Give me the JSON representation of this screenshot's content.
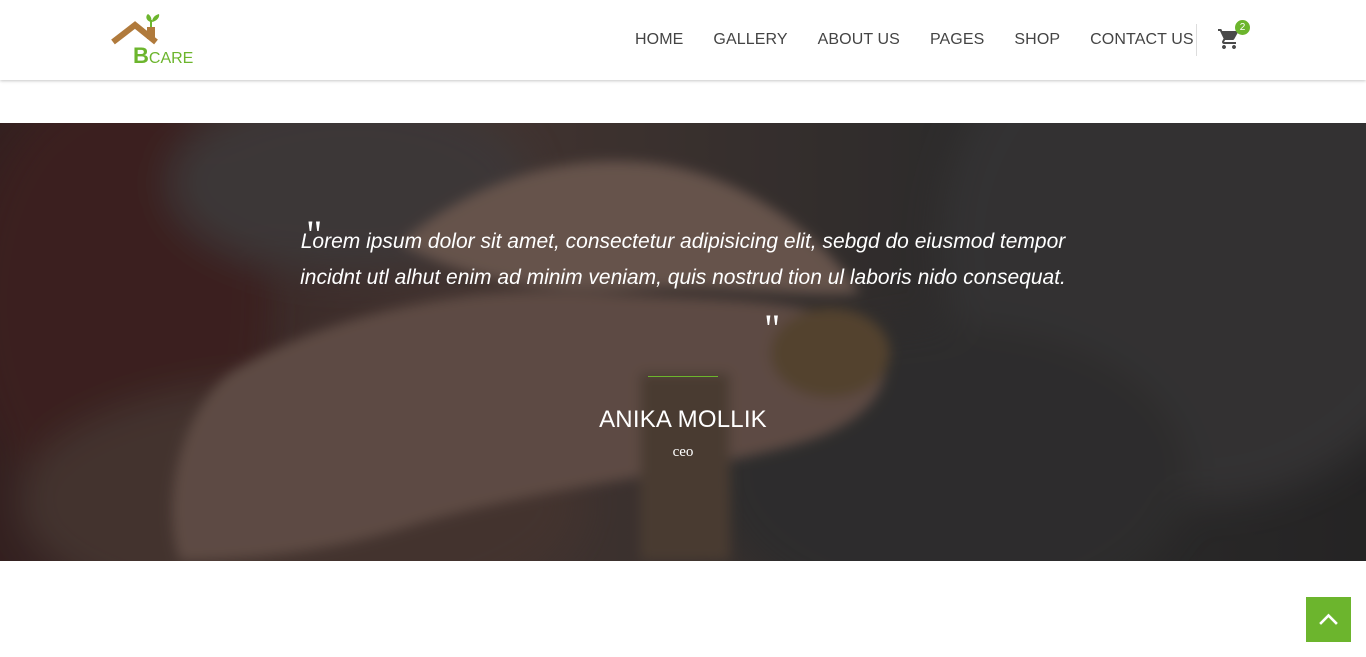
{
  "brand": {
    "logo_big": "B",
    "logo_small": "CARE",
    "accent_color": "#6cb52d",
    "roof_color": "#b07a3c"
  },
  "nav": {
    "items": [
      {
        "label": "HOME"
      },
      {
        "label": "GALLERY"
      },
      {
        "label": "ABOUT US"
      },
      {
        "label": "PAGES"
      },
      {
        "label": "SHOP"
      },
      {
        "label": "CONTACT US"
      }
    ]
  },
  "cart": {
    "icon": "cart-icon",
    "count": "2"
  },
  "testimonial": {
    "open_quote": "\"",
    "close_quote": "\"",
    "quote": "Lorem ipsum dolor sit amet, consectetur adipisicing elit, sebgd do eiusmod tempor incidnt utl alhut enim ad minim veniam, quis nostrud tion ul laboris nido consequat.",
    "author": "ANIKA MOLLIK",
    "role": "ceo"
  },
  "back_to_top": {
    "icon": "chevron-up-icon"
  }
}
